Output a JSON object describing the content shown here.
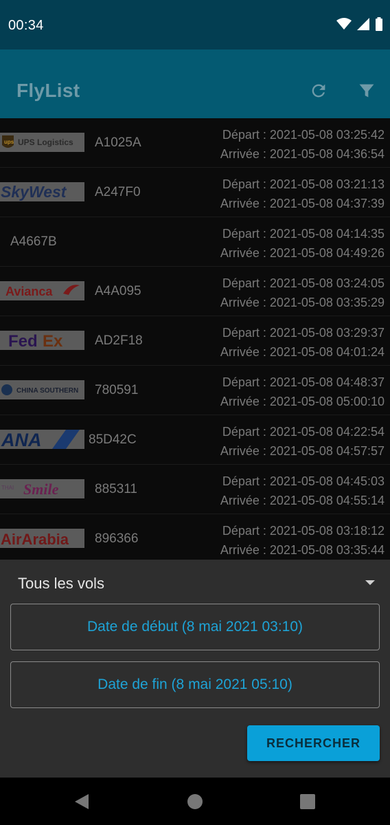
{
  "status_bar": {
    "time": "00:34",
    "icons": [
      "wifi-icon",
      "signal-icon",
      "battery-icon"
    ]
  },
  "app_bar": {
    "title": "FlyList",
    "actions": [
      "refresh-icon",
      "filter-icon"
    ]
  },
  "flights": [
    {
      "airline": "UPS Logistics",
      "logo_text": "UPS Logistics",
      "code": "A1025A",
      "depart": "Départ : 2021-05-08 03:25:42",
      "arrivee": "Arrivée : 2021-05-08 04:36:54"
    },
    {
      "airline": "SkyWest",
      "logo_text": "SkyWest",
      "code": "A247F0",
      "depart": "Départ : 2021-05-08 03:21:13",
      "arrivee": "Arrivée : 2021-05-08 04:37:39"
    },
    {
      "airline": "",
      "logo_text": "",
      "code": "A4667B",
      "depart": "Départ : 2021-05-08 04:14:35",
      "arrivee": "Arrivée : 2021-05-08 04:49:26"
    },
    {
      "airline": "Avianca",
      "logo_text": "Avianca",
      "code": "A4A095",
      "depart": "Départ : 2021-05-08 03:24:05",
      "arrivee": "Arrivée : 2021-05-08 03:35:29"
    },
    {
      "airline": "FedEx",
      "logo_text": "FedEx",
      "code": "AD2F18",
      "depart": "Départ : 2021-05-08 03:29:37",
      "arrivee": "Arrivée : 2021-05-08 04:01:24"
    },
    {
      "airline": "China Southern",
      "logo_text": "CHINA SOUTHERN",
      "code": "780591",
      "depart": "Départ : 2021-05-08 04:48:37",
      "arrivee": "Arrivée : 2021-05-08 05:00:10"
    },
    {
      "airline": "ANA",
      "logo_text": "ANA",
      "code": "85D42C",
      "depart": "Départ : 2021-05-08 04:22:54",
      "arrivee": "Arrivée : 2021-05-08 04:57:57"
    },
    {
      "airline": "Thai Smile",
      "logo_text": "THAI Smile",
      "code": "885311",
      "depart": "Départ : 2021-05-08 04:45:03",
      "arrivee": "Arrivée : 2021-05-08 04:55:14"
    },
    {
      "airline": "Air Arabia",
      "logo_text": "AirArabia",
      "code": "896366",
      "depart": "Départ : 2021-05-08 03:18:12",
      "arrivee": "Arrivée : 2021-05-08 03:35:44"
    }
  ],
  "filter_sheet": {
    "selected_option": "Tous les vols",
    "start_date_label": "Date de début (8 mai 2021 03:10)",
    "end_date_label": "Date de fin (8 mai 2021 05:10)",
    "search_label": "RECHERCHER"
  },
  "colors": {
    "accent": "#0aa0d8",
    "app_bar": "#045a72",
    "status_bar": "#033e52"
  },
  "nav_bar": [
    "back-icon",
    "home-icon",
    "recents-icon"
  ]
}
